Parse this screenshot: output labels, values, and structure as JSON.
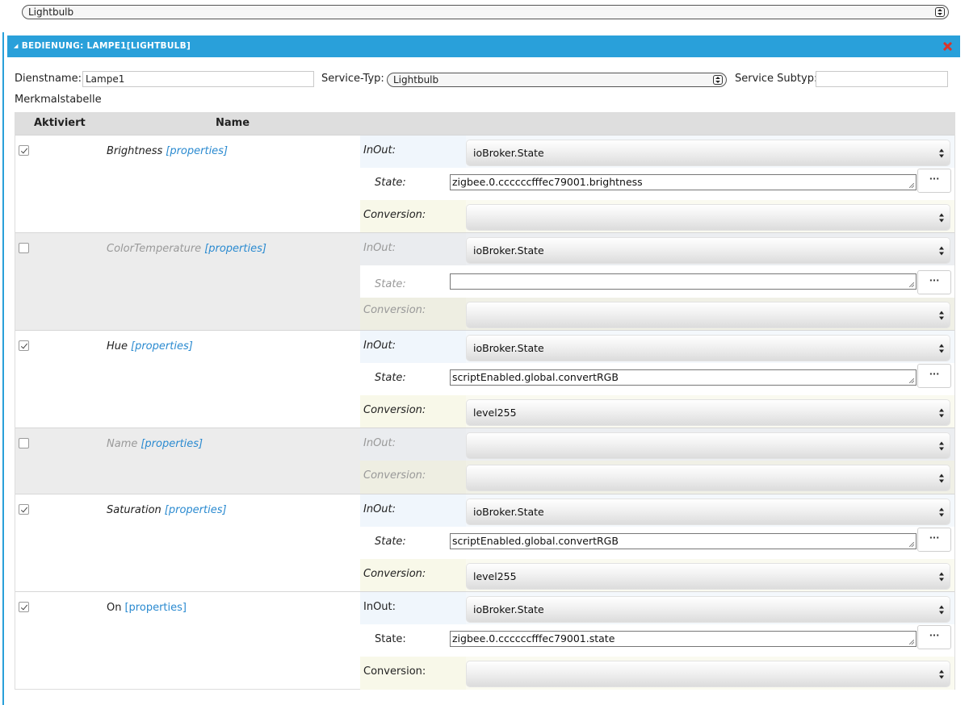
{
  "device_select": {
    "value": "Lightbulb"
  },
  "panel": {
    "title": "BEDIENUNG: LAMPE1[LIGHTBULB]"
  },
  "service": {
    "name_label": "Dienstname:",
    "name_value": "Lampe1",
    "type_label": "Service-Typ:",
    "type_value": "Lightbulb",
    "subtype_label": "Service Subtyp:",
    "subtype_value": ""
  },
  "table": {
    "caption": "Merkmalstabelle",
    "col_active": "Aktiviert",
    "col_name": "Name",
    "props_link": "[properties]",
    "labels": {
      "inout": "InOut:",
      "state": "State:",
      "conversion": "Conversion:"
    },
    "rows": [
      {
        "name": "Brightness",
        "checked": true,
        "inout": "ioBroker.State",
        "state": "zigbee.0.cccccc fffec79001.brightness",
        "conversion": ""
      },
      {
        "name": "ColorTemperature",
        "checked": false,
        "inout": "ioBroker.State",
        "state": "",
        "conversion": ""
      },
      {
        "name": "Hue",
        "checked": true,
        "inout": "ioBroker.State",
        "state": "scriptEnabled.global.convertRGB",
        "conversion": "level255"
      },
      {
        "name": "Name",
        "checked": false,
        "inout": "",
        "conversion": ""
      },
      {
        "name": "Saturation",
        "checked": true,
        "inout": "ioBroker.State",
        "state": "scriptEnabled.global.convertRGB",
        "conversion": "level255"
      },
      {
        "name": "On",
        "checked": true,
        "inout": "ioBroker.State",
        "state": "zigbee.0.ccccccfffec79001.state",
        "conversion": ""
      }
    ],
    "browse_button": "···"
  }
}
